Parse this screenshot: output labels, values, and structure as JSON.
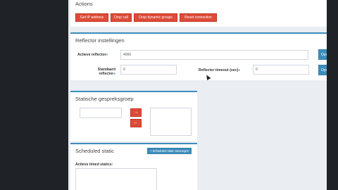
{
  "actions": {
    "title": "Actions",
    "buttons": [
      "Get IP address",
      "Drop call",
      "Drop dynamic groups",
      "Reset connection"
    ]
  },
  "reflector": {
    "title": "Reflector instellingen",
    "active_label": "Actieve reflector",
    "active_value": "4000",
    "default_label_1": "Standaard",
    "default_label_2": "reflector",
    "default_value": "0",
    "timeout_label": "Reflector timeout (sec)",
    "timeout_value": "0",
    "save_label": "Opsl"
  },
  "static_group": {
    "title": "Statische gespreksgroep",
    "input_value": "",
    "add_arrow": "→",
    "remove_arrow": "←"
  },
  "scheduled": {
    "title": "Scheduled static",
    "add_button": "+ Scheduled static toevoegen",
    "list_label": "Actieve timed statics:"
  },
  "colors": {
    "accent": "#3c8dbc",
    "danger": "#dd4b39",
    "sidebar": "#1f2327"
  }
}
